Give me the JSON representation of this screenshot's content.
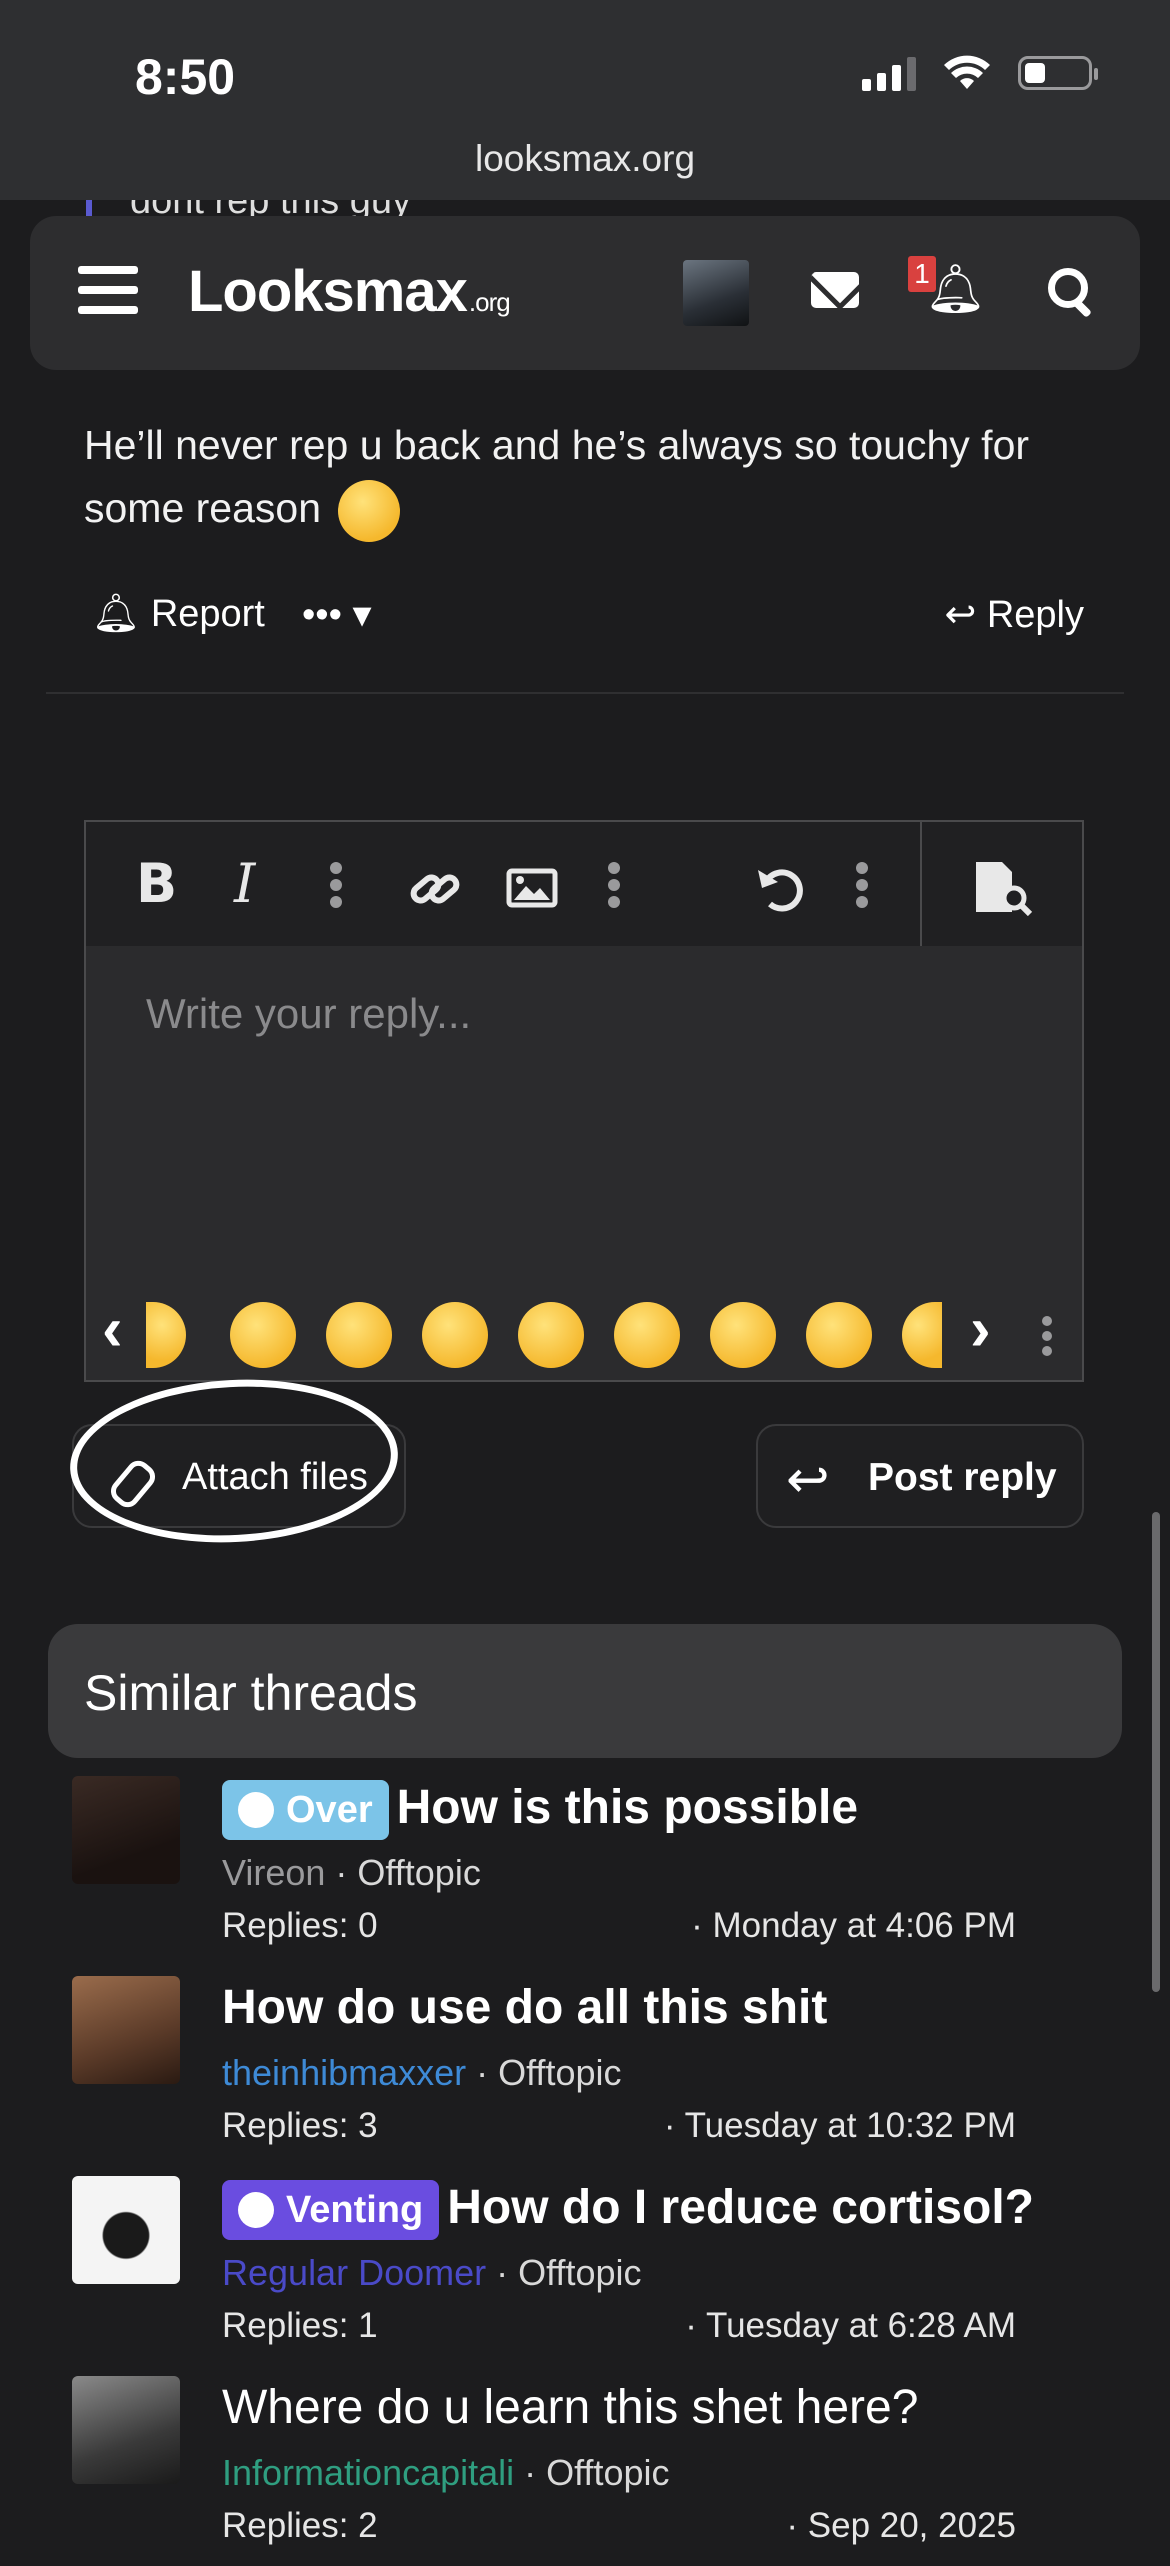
{
  "status": {
    "time": "8:50",
    "url": "looksmax.org"
  },
  "peek_text": "dont rep this guy",
  "header": {
    "logo": "Looksmax",
    "logo_suffix": ".org",
    "notification_count": "1"
  },
  "post": {
    "text": "He’ll never rep u back and he’s always so touchy for some reason",
    "report_label": "Report",
    "reply_label": "Reply"
  },
  "editor": {
    "placeholder": "Write your reply..."
  },
  "buttons": {
    "attach": "Attach files",
    "post_reply": "Post reply"
  },
  "similar": {
    "title": "Similar threads",
    "threads": [
      {
        "prefix": "Over",
        "prefix_color": "#7cc4e8",
        "title": "How is this possible",
        "user": "Vireon",
        "user_color": "#9a9a9c",
        "forum": "Offtopic",
        "replies": "Replies: 0",
        "date": "· Monday at 4:06 PM"
      },
      {
        "prefix": "",
        "title": "How do use do all this shit",
        "user": "theinhibmaxxer",
        "user_color": "#3e8ad6",
        "forum": "Offtopic",
        "replies": "Replies: 3",
        "date": "· Tuesday at 10:32 PM"
      },
      {
        "prefix": "Venting",
        "prefix_color": "#6a4de0",
        "title": "How do I reduce cortisol?",
        "user": "Regular Doomer",
        "user_color": "#4a4ac8",
        "forum": "Offtopic",
        "replies": "Replies: 1",
        "date": "· Tuesday at 6:28 AM"
      },
      {
        "prefix": "",
        "title": "Where do u learn this shet here?",
        "user": "Informationcapitali",
        "user_color": "#2f9e80",
        "forum": "Offtopic",
        "replies": "Replies: 2",
        "date": "· Sep 20, 2025"
      }
    ]
  }
}
